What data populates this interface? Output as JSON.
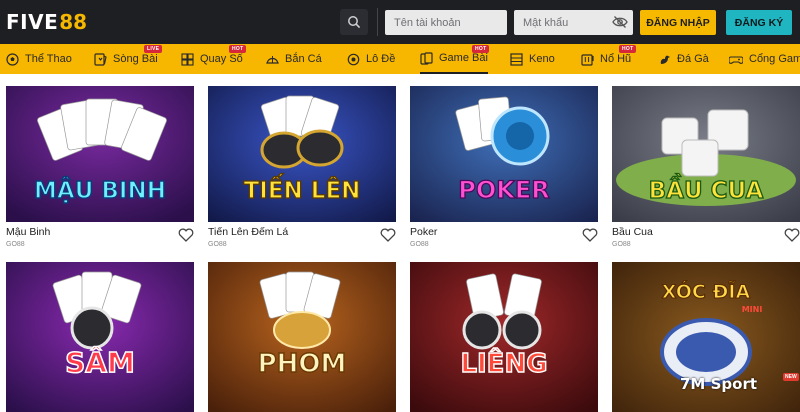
{
  "brand": {
    "logo_left": "FIVE",
    "logo_right": "88"
  },
  "header": {
    "username_placeholder": "Tên tài khoản",
    "password_placeholder": "Mật khẩu",
    "login_label": "ĐĂNG NHẬP",
    "register_label": "ĐĂNG KÝ"
  },
  "nav": {
    "items": [
      {
        "label": "Thể Thao",
        "icon": "soccer-ball-icon",
        "badge": ""
      },
      {
        "label": "Sòng Bài",
        "icon": "casino-chip-icon",
        "badge": "LIVE"
      },
      {
        "label": "Quay Số",
        "icon": "lottery-grid-icon",
        "badge": "HOT"
      },
      {
        "label": "Bắn Cá",
        "icon": "fish-icon",
        "badge": ""
      },
      {
        "label": "Lô Đề",
        "icon": "lotto-ball-icon",
        "badge": ""
      },
      {
        "label": "Game Bài",
        "icon": "playing-cards-icon",
        "badge": "HOT",
        "active": true
      },
      {
        "label": "Keno",
        "icon": "keno-board-icon",
        "badge": ""
      },
      {
        "label": "Nổ Hũ",
        "icon": "slot-machine-icon",
        "badge": "HOT"
      },
      {
        "label": "Đá Gà",
        "icon": "rooster-icon",
        "badge": ""
      },
      {
        "label": "Cổng Game",
        "icon": "gamepad-icon",
        "badge": ""
      }
    ]
  },
  "games": [
    {
      "title": "Mậu Binh",
      "provider": "GO88",
      "art": "MẬU BINH"
    },
    {
      "title": "Tiến Lên Đếm Lá",
      "provider": "GO88",
      "art": "TIẾN LÊN"
    },
    {
      "title": "Poker",
      "provider": "GO88",
      "art": "POKER"
    },
    {
      "title": "Bầu Cua",
      "provider": "GO88",
      "art": "BẦU CUA"
    },
    {
      "title": "",
      "provider": "",
      "art": "SÂM"
    },
    {
      "title": "",
      "provider": "",
      "art": "PHOM"
    },
    {
      "title": "",
      "provider": "",
      "art": "LIÊNG"
    },
    {
      "title": "",
      "provider": "",
      "art": "XÓC ĐĨA",
      "art_sub": "MINI"
    }
  ],
  "watermark": {
    "text_a": "7M",
    "text_b": " Sport",
    "tag": "NEW"
  },
  "colors": {
    "header_bg": "#1e1f23",
    "nav_bg": "#f7b600",
    "login_btn": "#f6b900",
    "register_btn": "#1fb6c2"
  }
}
